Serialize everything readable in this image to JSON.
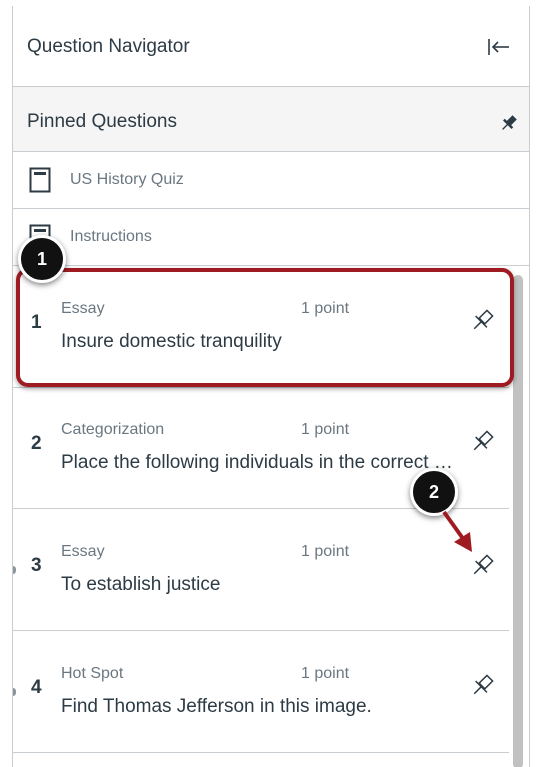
{
  "header": {
    "title": "Question Navigator",
    "collapse_icon": "collapse-left-icon"
  },
  "pinned": {
    "title": "Pinned Questions",
    "icon": "pin-icon"
  },
  "nav_items": [
    {
      "label": "US History Quiz",
      "icon": "document-icon"
    },
    {
      "label": "Instructions",
      "icon": "document-icon"
    }
  ],
  "questions": [
    {
      "number": "1",
      "type": "Essay",
      "points": "1 point",
      "text": "Insure domestic tranquility"
    },
    {
      "number": "2",
      "type": "Categorization",
      "points": "1 point",
      "text": "Place the following individuals in the correct category"
    },
    {
      "number": "3",
      "type": "Essay",
      "points": "1 point",
      "text": "To establish justice"
    },
    {
      "number": "4",
      "type": "Hot Spot",
      "points": "1 point",
      "text": "Find Thomas Jefferson in this image."
    }
  ],
  "callouts": [
    "1",
    "2"
  ],
  "colors": {
    "highlight": "#9e1b22",
    "text": "#2d3b45",
    "muted": "#6b7780",
    "border": "#c7cdd1"
  }
}
